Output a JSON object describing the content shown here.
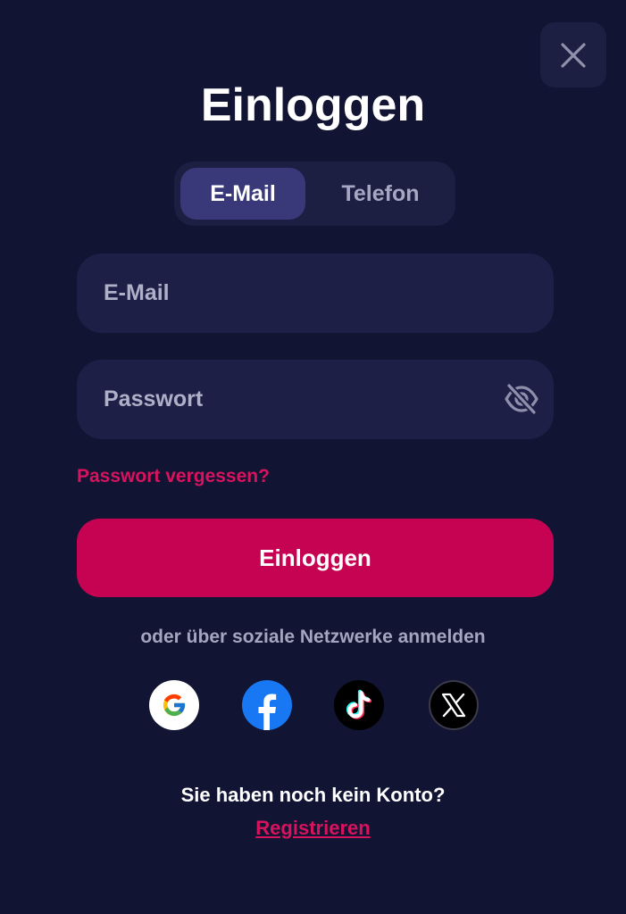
{
  "modal": {
    "title": "Einloggen",
    "close_icon": "close-icon"
  },
  "tabs": [
    {
      "label": "E-Mail",
      "active": true
    },
    {
      "label": "Telefon",
      "active": false
    }
  ],
  "email_field": {
    "value": "",
    "placeholder": "E-Mail"
  },
  "password_field": {
    "value": "",
    "placeholder": "Passwort",
    "toggle_icon": "eye-off-icon"
  },
  "forgot_password": "Passwort vergessen?",
  "login_button": "Einloggen",
  "social": {
    "text": "oder über soziale Netzwerke anmelden",
    "providers": [
      "google-icon",
      "facebook-icon",
      "tiktok-icon",
      "x-icon"
    ]
  },
  "no_account_text": "Sie haben noch kein Konto?",
  "register_link": "Registrieren",
  "colors": {
    "background": "#121433",
    "surface": "#1e1f47",
    "accent": "#c60353",
    "link": "#d8135e",
    "tab_active": "#39397a"
  }
}
